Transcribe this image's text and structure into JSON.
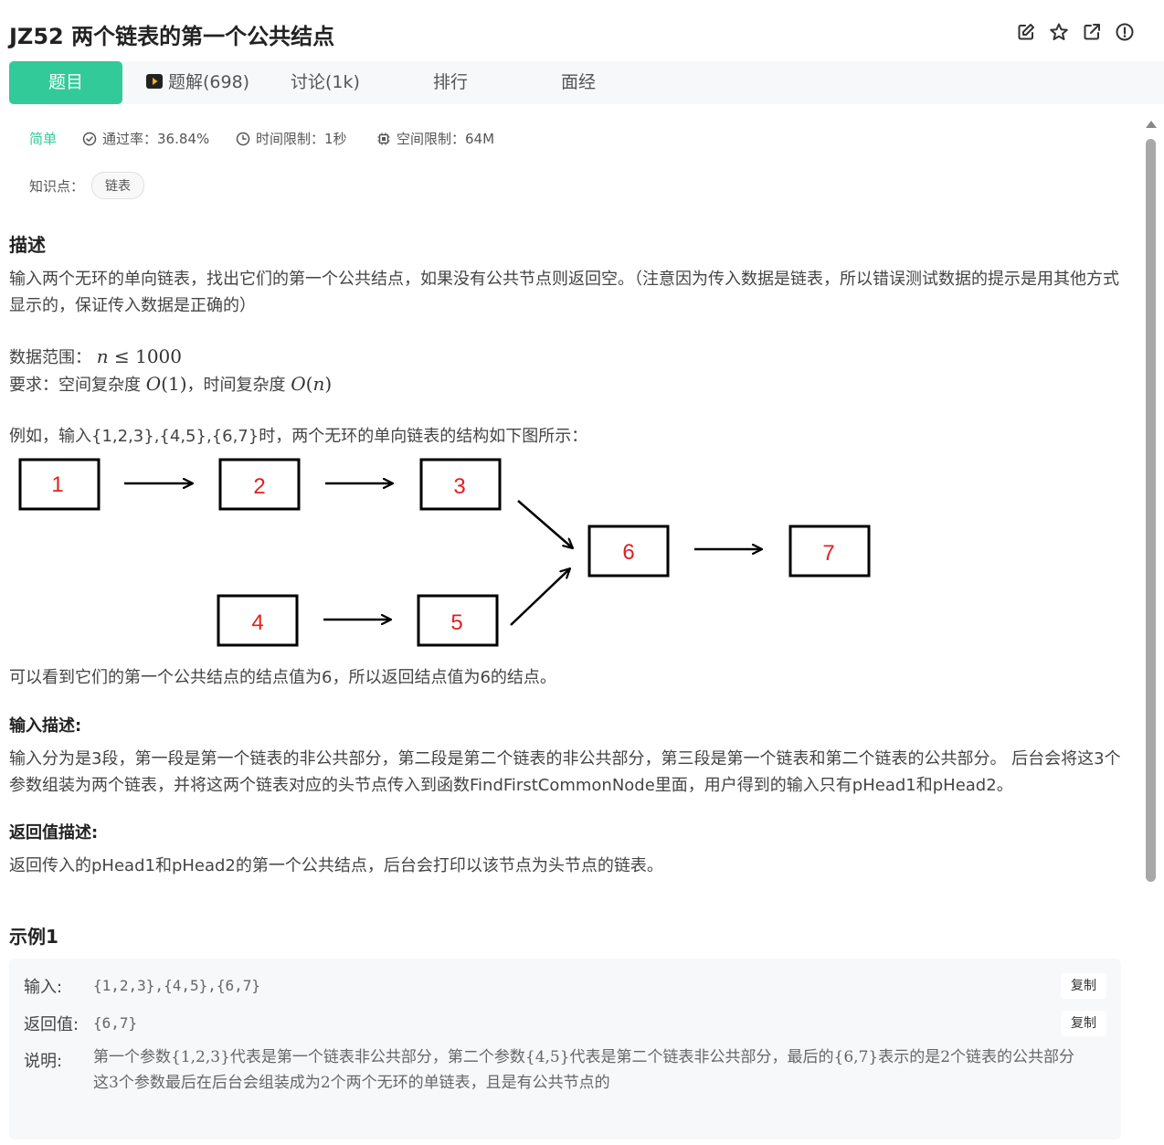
{
  "header": {
    "title": "JZ52  两个链表的第一个公共结点",
    "icons": [
      "edit-icon",
      "star-icon",
      "external-link-icon",
      "report-icon"
    ]
  },
  "tabs": [
    {
      "label": "题目",
      "active": true
    },
    {
      "label": "题解(698)",
      "icon": "video-play-icon"
    },
    {
      "label": "讨论(1k)"
    },
    {
      "label": "排行"
    },
    {
      "label": "面经"
    }
  ],
  "meta": {
    "difficulty": "简单",
    "pass_rate": "通过率：36.84%",
    "time_limit": "时间限制：1秒",
    "space_limit": "空间限制：64M",
    "colors": {
      "accent": "#32ca99"
    }
  },
  "knowledge": {
    "label": "知识点：",
    "tag": "链表"
  },
  "description": {
    "heading": "描述",
    "text": "输入两个无环的单向链表，找出它们的第一个公共结点，如果没有公共节点则返回空。（注意因为传入数据是链表，所以错误测试数据的提示是用其他方式显示的，保证传入数据是正确的）",
    "range_label": "数据范围：",
    "range_math": {
      "var": "n",
      "op": "≤",
      "value": "1000"
    },
    "req_label": "要求：空间复杂度",
    "req_space": {
      "O": "O",
      "arg": "1"
    },
    "req_sep": "，时间复杂度",
    "req_time": {
      "O": "O",
      "arg": "n"
    },
    "example_intro": "例如，输入{1,2,3},{4,5},{6,7}时，两个无环的单向链表的结构如下图所示：",
    "diagram": {
      "nodes": [
        "1",
        "2",
        "3",
        "4",
        "5",
        "6",
        "7"
      ],
      "node_color": "#e02020"
    },
    "conclusion": "可以看到它们的第一个公共结点的结点值为6，所以返回结点值为6的结点。"
  },
  "input_desc": {
    "heading": "输入描述:",
    "text": "输入分为是3段，第一段是第一个链表的非公共部分，第二段是第二个链表的非公共部分，第三段是第一个链表和第二个链表的公共部分。 后台会将这3个参数组装为两个链表，并将这两个链表对应的头节点传入到函数FindFirstCommonNode里面，用户得到的输入只有pHead1和pHead2。"
  },
  "return_desc": {
    "heading": "返回值描述:",
    "text": "返回传入的pHead1和pHead2的第一个公共结点，后台会打印以该节点为头节点的链表。"
  },
  "example1": {
    "heading": "示例1",
    "input_label": "输入:",
    "input_value": "{1,2,3},{4,5},{6,7}",
    "output_label": "返回值:",
    "output_value": "{6,7}",
    "note_label": "说明:",
    "note_line1": "第一个参数{1,2,3}代表是第一个链表非公共部分，第二个参数{4,5}代表是第二个链表非公共部分，最后的{6,7}表示的是2个链表的公共部分",
    "note_line2": "这3个参数最后在后台会组装成为2个两个无环的单链表，且是有公共节点的",
    "copy_label": "复制"
  }
}
